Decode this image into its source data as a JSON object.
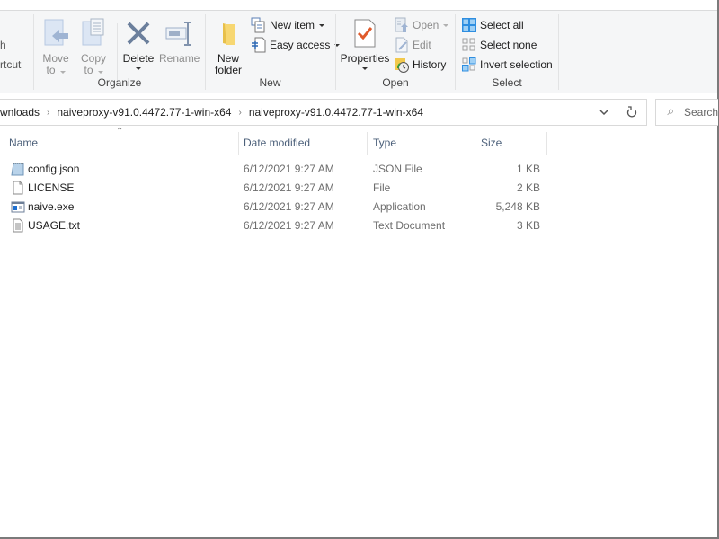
{
  "ribbon": {
    "partial_left": {
      "line1": "h",
      "line2": "rtcut"
    },
    "organize": {
      "label": "Organize",
      "move_to": {
        "line1": "Move",
        "line2": "to"
      },
      "copy_to": {
        "line1": "Copy",
        "line2": "to"
      },
      "delete": "Delete",
      "rename": "Rename"
    },
    "new": {
      "label": "New",
      "new_folder": {
        "line1": "New",
        "line2": "folder"
      },
      "new_item": "New item",
      "easy_access": "Easy access"
    },
    "open": {
      "label": "Open",
      "properties": "Properties",
      "open": "Open",
      "edit": "Edit",
      "history": "History"
    },
    "select": {
      "label": "Select",
      "select_all": "Select all",
      "select_none": "Select none",
      "invert_selection": "Invert selection"
    }
  },
  "address": {
    "crumbs": [
      "wnloads",
      "naiveproxy-v91.0.4472.77-1-win-x64",
      "naiveproxy-v91.0.4472.77-1-win-x64"
    ]
  },
  "search": {
    "placeholder": "Search"
  },
  "columns": {
    "name": "Name",
    "date": "Date modified",
    "type": "Type",
    "size": "Size"
  },
  "files": [
    {
      "name": "config.json",
      "date": "6/12/2021 9:27 AM",
      "type": "JSON File",
      "size": "1 KB",
      "icon": "json-file-icon"
    },
    {
      "name": "LICENSE",
      "date": "6/12/2021 9:27 AM",
      "type": "File",
      "size": "2 KB",
      "icon": "blank-file-icon"
    },
    {
      "name": "naive.exe",
      "date": "6/12/2021 9:27 AM",
      "type": "Application",
      "size": "5,248 KB",
      "icon": "application-icon"
    },
    {
      "name": "USAGE.txt",
      "date": "6/12/2021 9:27 AM",
      "type": "Text Document",
      "size": "3 KB",
      "icon": "text-file-icon"
    }
  ]
}
